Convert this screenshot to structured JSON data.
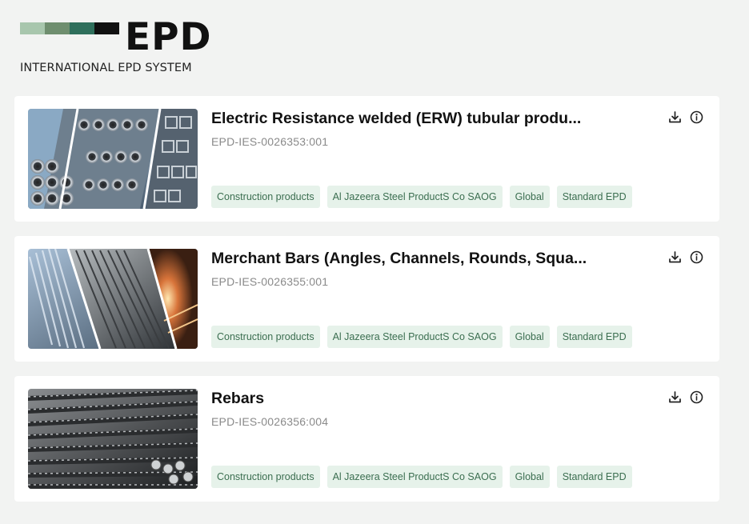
{
  "brand": {
    "logo_text": "EPD",
    "subtitle": "INTERNATIONAL EPD SYSTEM",
    "bar_colors": [
      "#a8c6ad",
      "#6f8e6f",
      "#2f6f5c",
      "#111111"
    ]
  },
  "icons": {
    "download": "download-icon",
    "info": "info-icon"
  },
  "colors": {
    "tag_bg": "#e6f2ea",
    "tag_text": "#3b6e50"
  },
  "results": [
    {
      "title": "Electric Resistance welded (ERW) tubular produ...",
      "id": "EPD-IES-0026353:001",
      "image": "steel-tubes",
      "tags": [
        "Construction products",
        "Al Jazeera Steel ProductS Co SAOG",
        "Global",
        "Standard EPD"
      ]
    },
    {
      "title": "Merchant Bars (Angles, Channels, Rounds, Squa...",
      "id": "EPD-IES-0026355:001",
      "image": "steel-bars",
      "tags": [
        "Construction products",
        "Al Jazeera Steel ProductS Co SAOG",
        "Global",
        "Standard EPD"
      ]
    },
    {
      "title": "Rebars",
      "id": "EPD-IES-0026356:004",
      "image": "rebars",
      "tags": [
        "Construction products",
        "Al Jazeera Steel ProductS Co SAOG",
        "Global",
        "Standard EPD"
      ]
    }
  ]
}
